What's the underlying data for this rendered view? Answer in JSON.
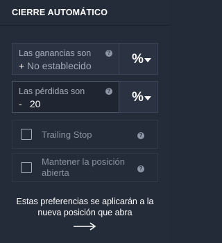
{
  "header": {
    "title": "CIERRE AUTOMÁTICO"
  },
  "take_profit": {
    "label": "Las ganancias son",
    "sign": "+",
    "placeholder": "No establecido",
    "unit": "%"
  },
  "stop_loss": {
    "label": "Las pérdidas son",
    "sign": "-",
    "value": "20",
    "unit": "%"
  },
  "options": [
    {
      "label": "Trailing Stop",
      "checked": false
    },
    {
      "label": "Mantener la posición abierta",
      "checked": false
    }
  ],
  "help_icon_glyph": "?",
  "note": "Estas preferencias se aplicarán a la nueva posición que abra"
}
